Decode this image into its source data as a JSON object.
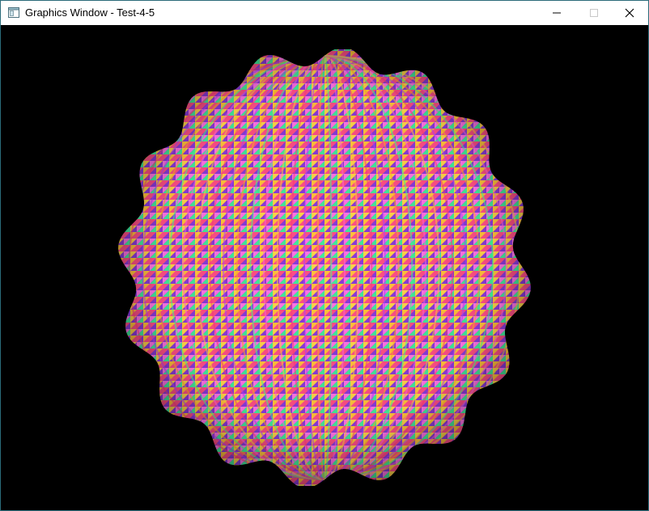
{
  "window": {
    "title": "Graphics Window - Test-4-5",
    "app_icon": "application-window-icon",
    "controls": {
      "minimize_icon": "minimize-icon",
      "maximize_icon": "maximize-icon",
      "close_icon": "close-icon"
    }
  },
  "viewport": {
    "background_color": "#000000",
    "object": "wavy-sphere-mesh",
    "object_description_colors": [
      "#ff3b7a",
      "#b040ff",
      "#ffb020",
      "#40ff90",
      "#ff60e0",
      "#ffd040"
    ]
  }
}
